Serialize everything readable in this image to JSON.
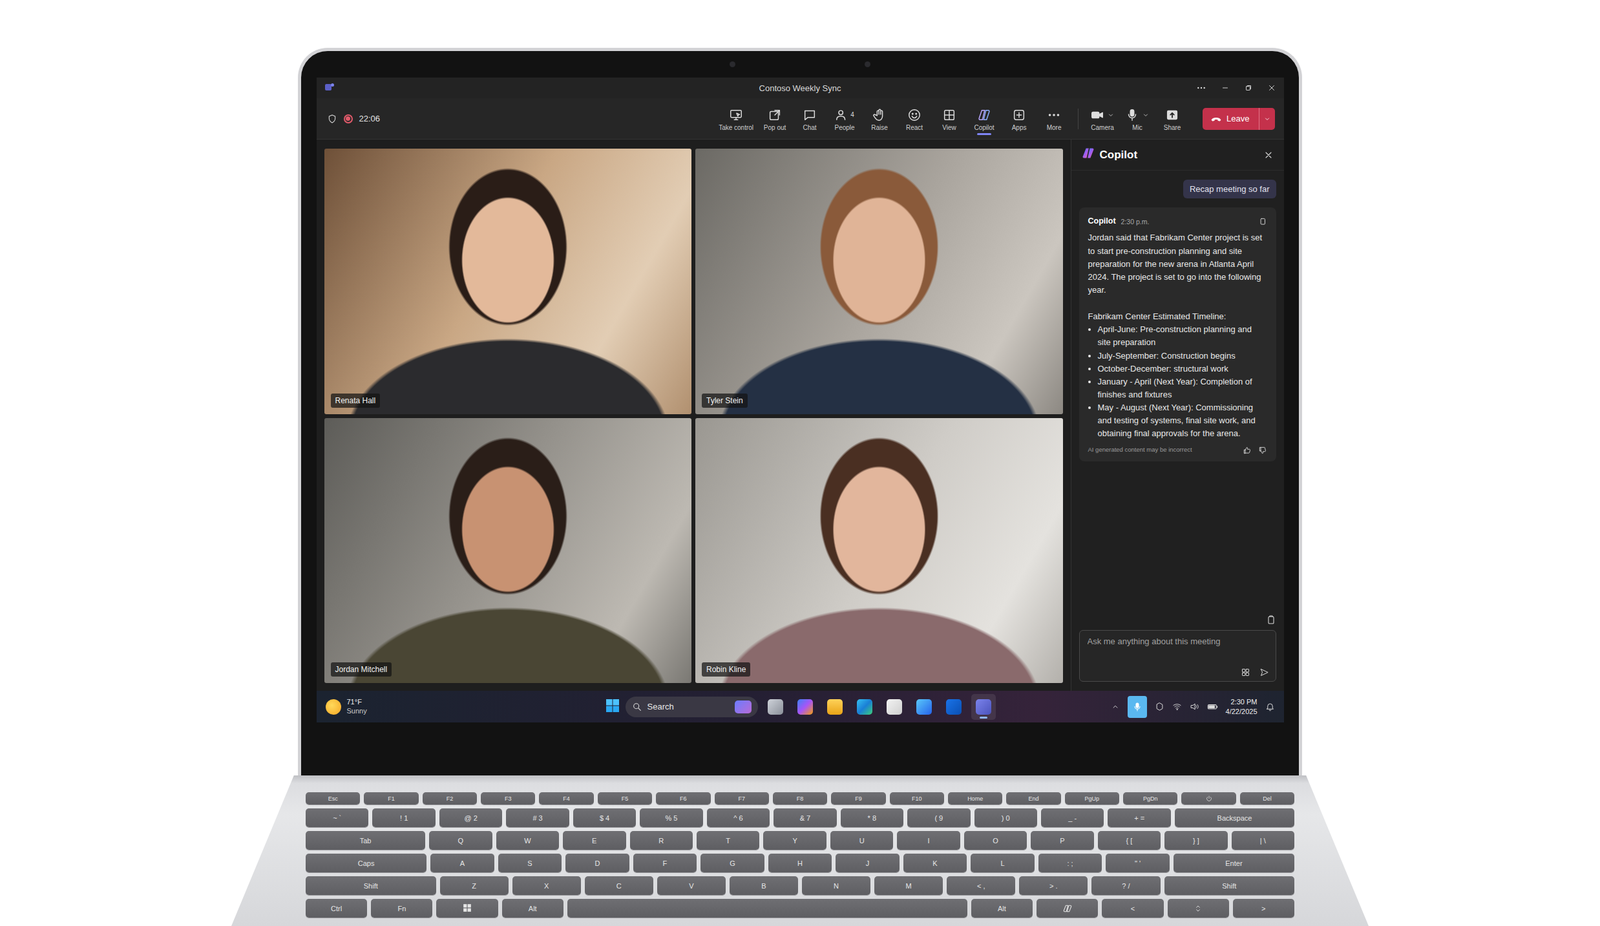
{
  "window": {
    "title": "Contoso Weekly Sync"
  },
  "meeting": {
    "recording": true,
    "timer": "22:06"
  },
  "toolbar": {
    "items": [
      {
        "label": "Take control",
        "selected": false,
        "dropdown": false,
        "kind": "tool"
      },
      {
        "label": "Pop out",
        "selected": false,
        "dropdown": false,
        "kind": "tool"
      },
      {
        "label": "Chat",
        "selected": false,
        "dropdown": false,
        "kind": "tool"
      },
      {
        "label": "People",
        "badge": "4",
        "selected": false,
        "dropdown": false,
        "kind": "tool"
      },
      {
        "label": "Raise",
        "selected": false,
        "dropdown": false,
        "kind": "tool"
      },
      {
        "label": "React",
        "selected": false,
        "dropdown": false,
        "kind": "tool"
      },
      {
        "label": "View",
        "selected": false,
        "dropdown": false,
        "kind": "tool"
      },
      {
        "label": "Copilot",
        "selected": true,
        "dropdown": false,
        "kind": "tool"
      },
      {
        "label": "Apps",
        "selected": false,
        "dropdown": false,
        "kind": "tool"
      },
      {
        "label": "More",
        "selected": false,
        "dropdown": false,
        "kind": "tool"
      },
      {
        "label": "Camera",
        "selected": false,
        "dropdown": true,
        "kind": "device"
      },
      {
        "label": "Mic",
        "selected": false,
        "dropdown": true,
        "kind": "device"
      },
      {
        "label": "Share",
        "selected": false,
        "dropdown": false,
        "kind": "device"
      }
    ]
  },
  "leave": {
    "label": "Leave"
  },
  "participants": [
    {
      "name": "Renata Hall"
    },
    {
      "name": "Tyler Stein"
    },
    {
      "name": "Jordan Mitchell"
    },
    {
      "name": "Robin Kline"
    }
  ],
  "copilot": {
    "title": "Copilot",
    "prompt": "Recap meeting so far",
    "response": {
      "author": "Copilot",
      "time": "2:30 p.m.",
      "summary": "Jordan said that Fabrikam Center project is set to start pre-construction planning and site preparation for the new arena in Atlanta April 2024. The project is set to go into the following year.",
      "timeline_title": "Fabrikam Center Estimated Timeline:",
      "timeline": [
        "April-June: Pre-construction planning and site preparation",
        "July-September: Construction begins",
        "October-December: structural work",
        "January - April (Next Year): Completion of finishes and fixtures",
        "May - August (Next Year): Commissioning and testing of systems, final site work, and obtaining final approvals for the arena."
      ],
      "disclaimer": "AI generated content may be incorrect"
    },
    "input": {
      "placeholder": "Ask me anything about this meeting"
    }
  },
  "taskbar": {
    "weather": {
      "temp": "71°F",
      "condition": "Sunny"
    },
    "search": {
      "label": "Search"
    },
    "apps": [
      {
        "selected": false
      },
      {
        "selected": false
      },
      {
        "selected": false
      },
      {
        "selected": false
      },
      {
        "selected": false
      },
      {
        "selected": false
      },
      {
        "selected": false
      },
      {
        "selected": true
      }
    ],
    "tray": {
      "mic_active": true
    },
    "clock": {
      "time": "2:30 PM",
      "date": "4/22/2025"
    }
  },
  "keyboard": {
    "rows": [
      [
        {
          "label": "Esc",
          "kind": "key"
        },
        {
          "label": "F1",
          "kind": "key"
        },
        {
          "label": "F2",
          "kind": "key"
        },
        {
          "label": "F3",
          "kind": "key"
        },
        {
          "label": "F4",
          "kind": "key"
        },
        {
          "label": "F5",
          "kind": "key"
        },
        {
          "label": "F6",
          "kind": "key"
        },
        {
          "label": "F7",
          "kind": "key"
        },
        {
          "label": "F8",
          "kind": "key"
        },
        {
          "label": "F9",
          "kind": "key"
        },
        {
          "label": "F10",
          "kind": "key"
        },
        {
          "label": "Home",
          "kind": "key"
        },
        {
          "label": "End",
          "kind": "key"
        },
        {
          "label": "PgUp",
          "kind": "key"
        },
        {
          "label": "PgDn",
          "kind": "key"
        },
        {
          "kind": "power"
        },
        {
          "label": "Del",
          "kind": "key"
        }
      ],
      [
        {
          "label": "~ `",
          "kind": "key"
        },
        {
          "label": "! 1",
          "kind": "key"
        },
        {
          "label": "@ 2",
          "kind": "key"
        },
        {
          "label": "# 3",
          "kind": "key"
        },
        {
          "label": "$ 4",
          "kind": "key"
        },
        {
          "label": "% 5",
          "kind": "key"
        },
        {
          "label": "^ 6",
          "kind": "key"
        },
        {
          "label": "& 7",
          "kind": "key"
        },
        {
          "label": "* 8",
          "kind": "key"
        },
        {
          "label": "( 9",
          "kind": "key"
        },
        {
          "label": ") 0",
          "kind": "key"
        },
        {
          "label": "_ -",
          "kind": "key"
        },
        {
          "label": "+ =",
          "kind": "key"
        },
        {
          "label": "Backspace",
          "kind": "wide"
        }
      ],
      [
        {
          "label": "Tab",
          "kind": "wide"
        },
        {
          "label": "Q",
          "kind": "key"
        },
        {
          "label": "W",
          "kind": "key"
        },
        {
          "label": "E",
          "kind": "key"
        },
        {
          "label": "R",
          "kind": "key"
        },
        {
          "label": "T",
          "kind": "key"
        },
        {
          "label": "Y",
          "kind": "key"
        },
        {
          "label": "U",
          "kind": "key"
        },
        {
          "label": "I",
          "kind": "key"
        },
        {
          "label": "O",
          "kind": "key"
        },
        {
          "label": "P",
          "kind": "key"
        },
        {
          "label": "{ [",
          "kind": "key"
        },
        {
          "label": "} ]",
          "kind": "key"
        },
        {
          "label": "| \\",
          "kind": "key"
        }
      ],
      [
        {
          "label": "Caps",
          "kind": "wide"
        },
        {
          "label": "A",
          "kind": "key"
        },
        {
          "label": "S",
          "kind": "key"
        },
        {
          "label": "D",
          "kind": "key"
        },
        {
          "label": "F",
          "kind": "key"
        },
        {
          "label": "G",
          "kind": "key"
        },
        {
          "label": "H",
          "kind": "key"
        },
        {
          "label": "J",
          "kind": "key"
        },
        {
          "label": "K",
          "kind": "key"
        },
        {
          "label": "L",
          "kind": "key"
        },
        {
          "label": ": ;",
          "kind": "key"
        },
        {
          "label": "\" '",
          "kind": "key"
        },
        {
          "label": "Enter",
          "kind": "wide"
        }
      ],
      [
        {
          "label": "Shift",
          "kind": "wide"
        },
        {
          "label": "Z",
          "kind": "key"
        },
        {
          "label": "X",
          "kind": "key"
        },
        {
          "label": "C",
          "kind": "key"
        },
        {
          "label": "V",
          "kind": "key"
        },
        {
          "label": "B",
          "kind": "key"
        },
        {
          "label": "N",
          "kind": "key"
        },
        {
          "label": "M",
          "kind": "key"
        },
        {
          "label": "< ,",
          "kind": "key"
        },
        {
          "label": "> .",
          "kind": "key"
        },
        {
          "label": "? /",
          "kind": "key"
        },
        {
          "label": "Shift",
          "kind": "wide"
        }
      ],
      [
        {
          "label": "Ctrl",
          "kind": "key"
        },
        {
          "label": "Fn",
          "kind": "key"
        },
        {
          "kind": "win"
        },
        {
          "label": "Alt",
          "kind": "key"
        },
        {
          "kind": "space"
        },
        {
          "label": "Alt",
          "kind": "key"
        },
        {
          "kind": "copilot"
        },
        {
          "label": "<",
          "kind": "key"
        },
        {
          "kind": "updown"
        },
        {
          "label": ">",
          "kind": "key"
        }
      ]
    ]
  }
}
